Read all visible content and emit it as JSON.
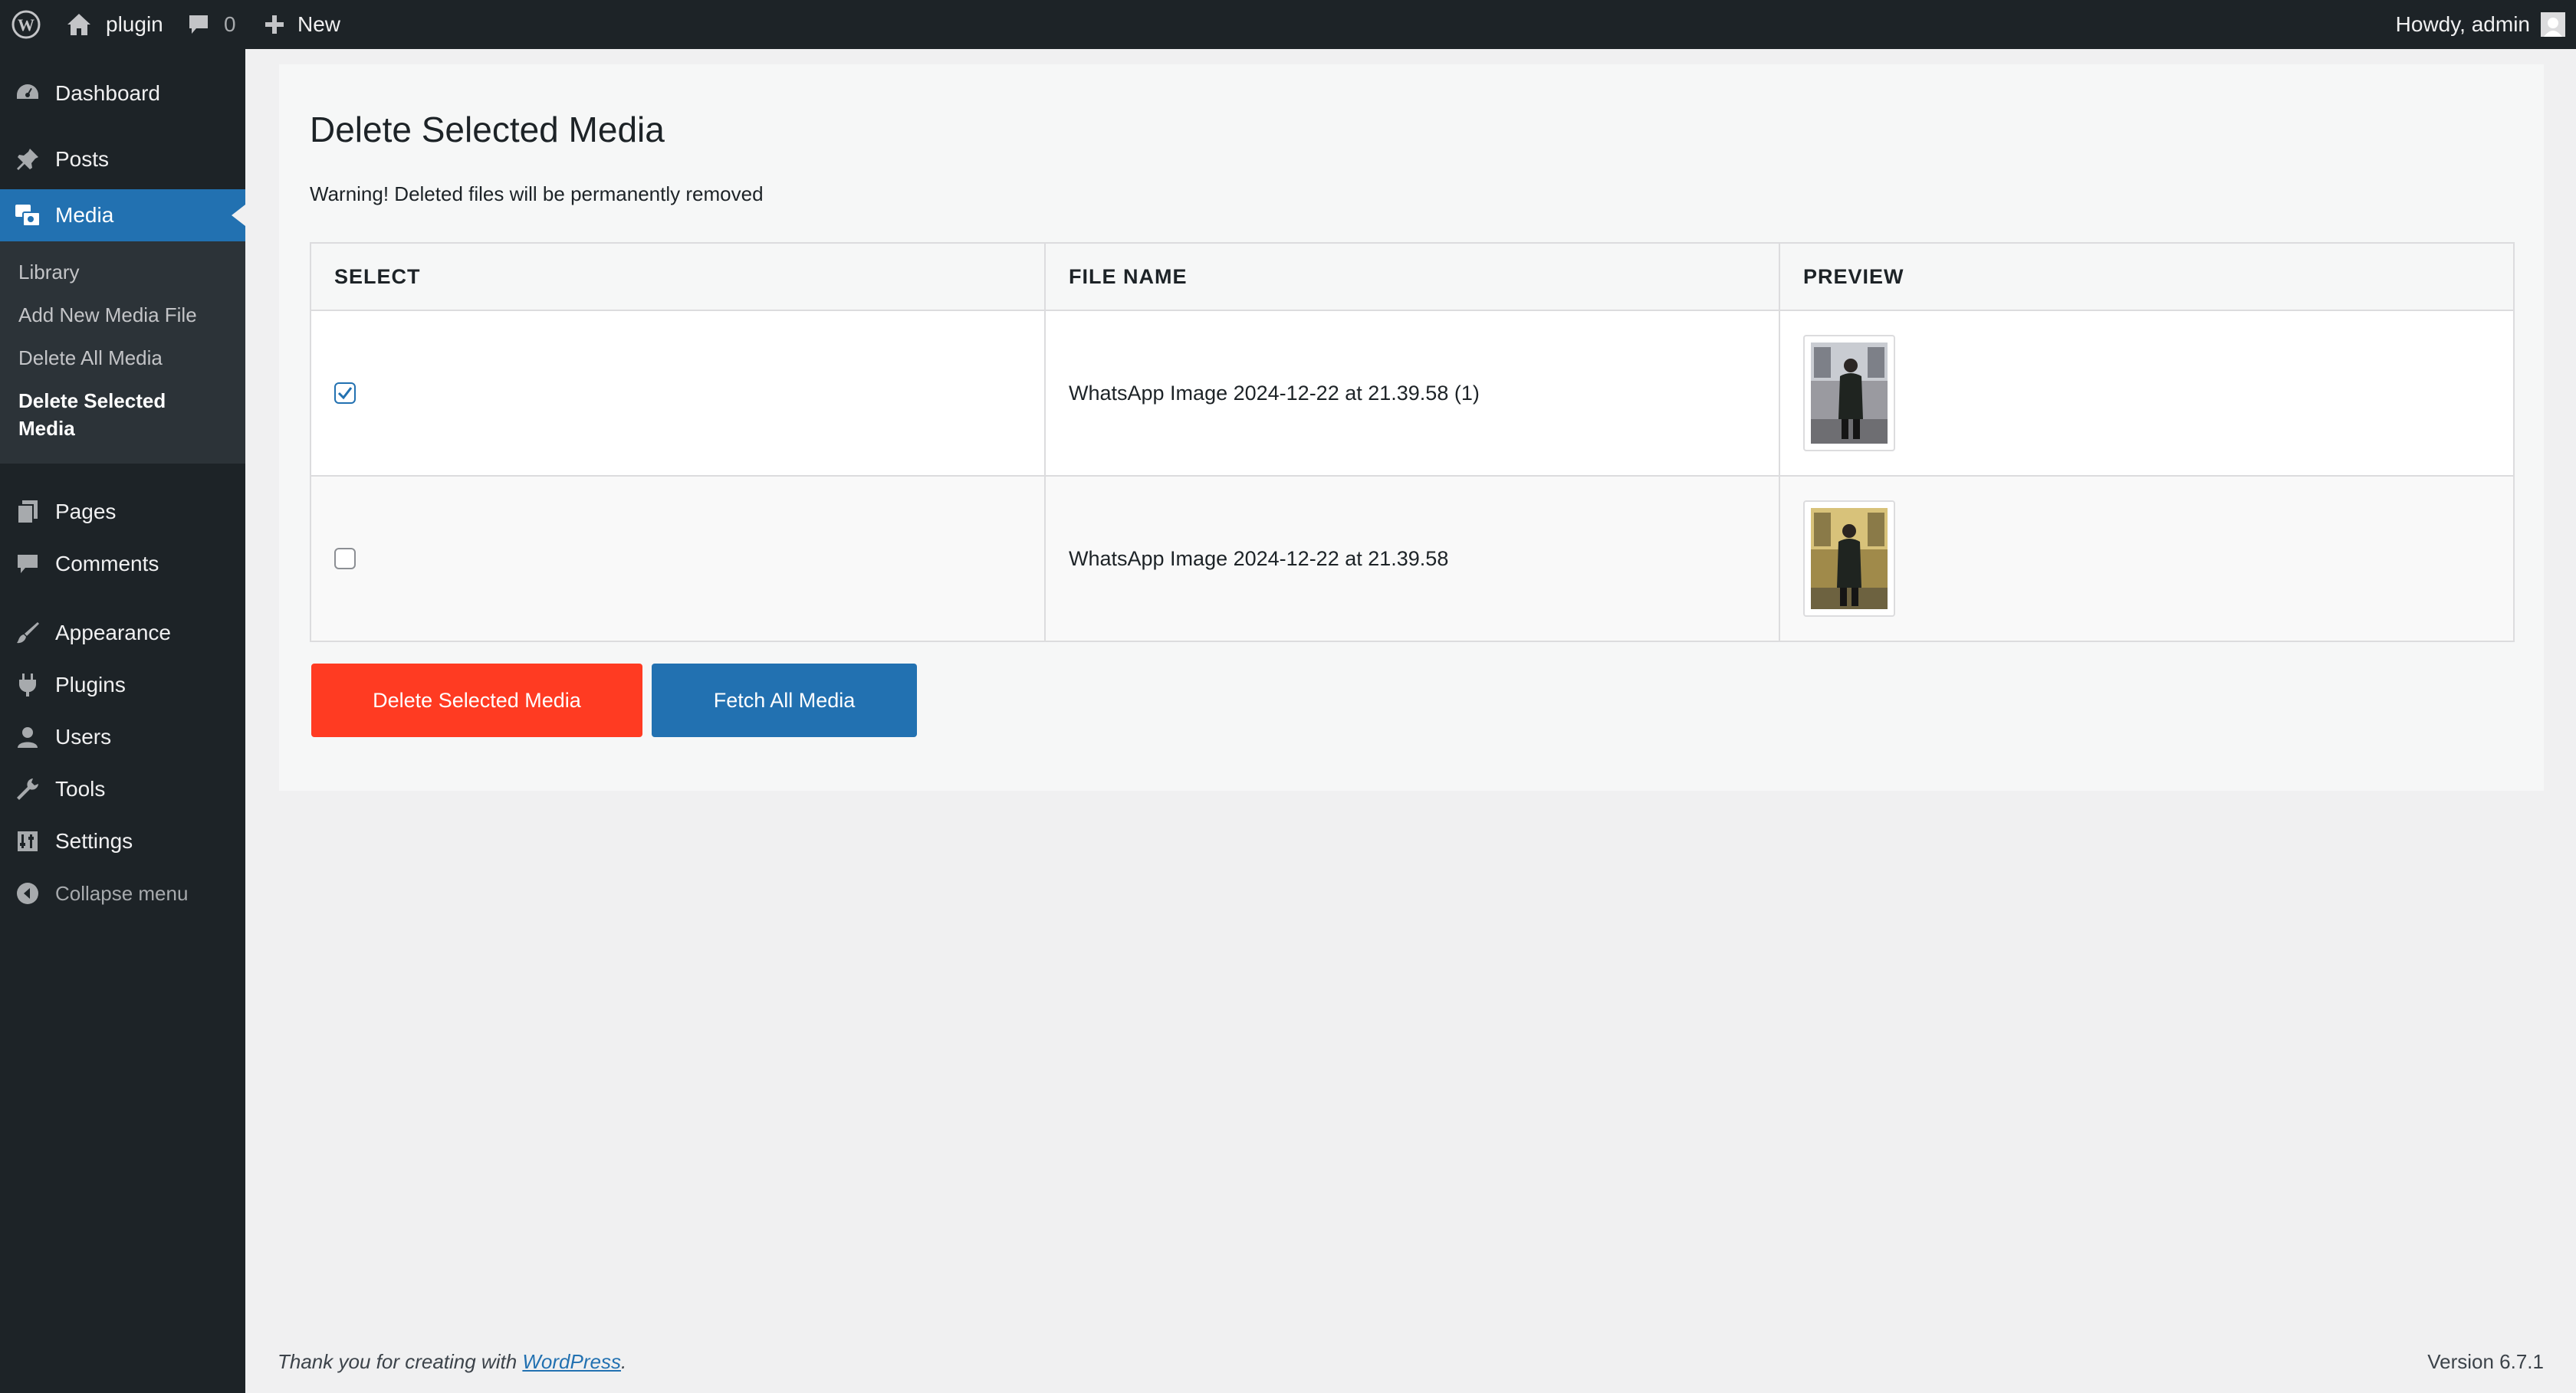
{
  "adminbar": {
    "site_name": "plugin",
    "comments_count": "0",
    "new_label": "New",
    "greeting": "Howdy, admin"
  },
  "sidebar": {
    "items": [
      {
        "label": "Dashboard",
        "icon": "dashboard-icon"
      },
      {
        "label": "Posts",
        "icon": "pushpin-icon"
      },
      {
        "label": "Media",
        "icon": "media-icon"
      },
      {
        "label": "Pages",
        "icon": "pages-icon"
      },
      {
        "label": "Comments",
        "icon": "comment-icon"
      },
      {
        "label": "Appearance",
        "icon": "paintbrush-icon"
      },
      {
        "label": "Plugins",
        "icon": "plug-icon"
      },
      {
        "label": "Users",
        "icon": "user-icon"
      },
      {
        "label": "Tools",
        "icon": "wrench-icon"
      },
      {
        "label": "Settings",
        "icon": "settings-icon"
      }
    ],
    "submenu": [
      {
        "label": "Library"
      },
      {
        "label": "Add New Media File"
      },
      {
        "label": "Delete All Media"
      },
      {
        "label": "Delete Selected Media"
      }
    ],
    "collapse_label": "Collapse menu"
  },
  "main": {
    "title": "Delete Selected Media",
    "warning": "Warning! Deleted files will be permanently removed",
    "table": {
      "headers": [
        "SELECT",
        "FILE NAME",
        "PREVIEW"
      ],
      "rows": [
        {
          "checked": true,
          "file_name": "WhatsApp Image 2024-12-22 at 21.39.58 (1)"
        },
        {
          "checked": false,
          "file_name": "WhatsApp Image 2024-12-22 at 21.39.58"
        }
      ]
    },
    "delete_button": "Delete Selected Media",
    "fetch_button": "Fetch All Media"
  },
  "footer": {
    "thanks_prefix": "Thank you for creating with ",
    "thanks_link": "WordPress",
    "thanks_suffix": ".",
    "version": "Version 6.7.1"
  },
  "colors": {
    "adminbar_bg": "#1d2327",
    "menu_current": "#2271b1",
    "delete_button": "#ff3b22",
    "fetch_button": "#2271b1"
  }
}
